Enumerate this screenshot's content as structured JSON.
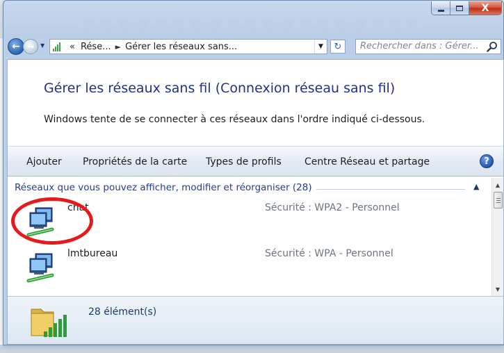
{
  "window": {
    "caption_minimize": "minimize",
    "caption_maximize": "maximize",
    "close_label": "X"
  },
  "nav": {
    "back_glyph": "←",
    "forward_glyph": "→",
    "history_glyph": "▼"
  },
  "address": {
    "overflow": "«",
    "crumb1": "Rése...",
    "separator": "►",
    "crumb2": "Gérer les réseaux sans...",
    "dropdown_glyph": "▼",
    "refresh_glyph": "↻"
  },
  "search": {
    "placeholder": "Rechercher dans : Gérer..."
  },
  "page": {
    "title": "Gérer les réseaux sans fil (Connexion réseau sans fil)",
    "description": "Windows tente de se connecter à ces réseaux dans l'ordre indiqué ci-dessous."
  },
  "toolbar": {
    "add": "Ajouter",
    "adapter_properties": "Propriétés de la carte",
    "profile_types": "Types de profils",
    "network_center": "Centre Réseau et partage",
    "help_glyph": "?"
  },
  "group": {
    "header": "Réseaux que vous pouvez afficher, modifier et réorganiser (28)",
    "collapse_glyph": "▲"
  },
  "networks": [
    {
      "name": "chat",
      "security": "Sécurité : WPA2 - Personnel"
    },
    {
      "name": "lmtbureau",
      "security": "Sécurité : WPA - Personnel"
    }
  ],
  "scrollbar": {
    "up": "▲",
    "down": "▼"
  },
  "status": {
    "count": "28 élément(s)"
  },
  "colors": {
    "title_blue": "#1e3287",
    "link_blue": "#1e3c9b",
    "annotation_red": "#e8191c",
    "close_red": "#c8371f"
  }
}
